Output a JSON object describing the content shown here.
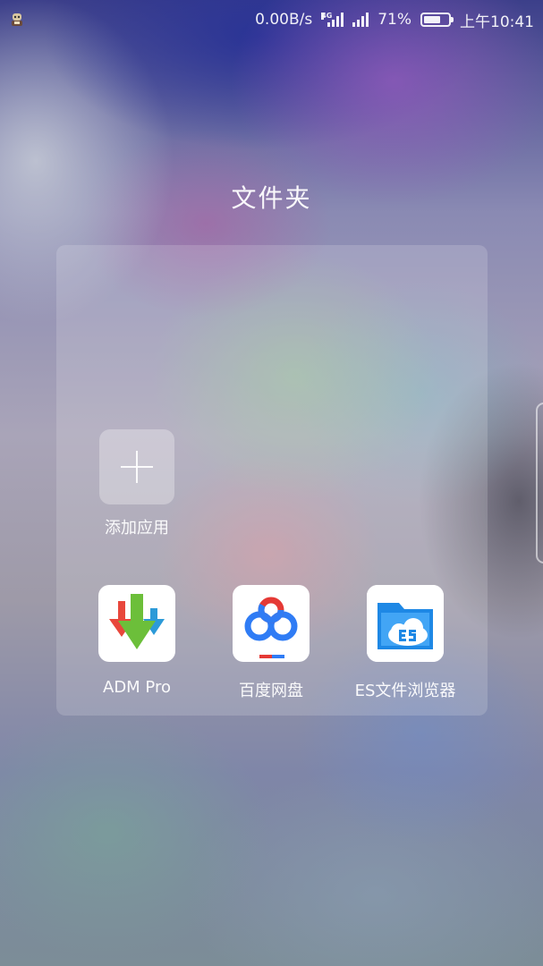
{
  "status_bar": {
    "net_speed": "0.00B/s",
    "network_type": "4G",
    "battery_percent": "71%",
    "battery_level": 0.71,
    "time": "上午10:41",
    "icons": [
      "notification-icon",
      "signal-4g-icon",
      "signal-icon",
      "battery-icon"
    ]
  },
  "folder": {
    "title": "文件夹",
    "add_label": "添加应用",
    "apps": [
      {
        "name": "ADM Pro",
        "icon": "adm-pro-icon"
      },
      {
        "name": "百度网盘",
        "icon": "baidu-netdisk-icon"
      },
      {
        "name": "ES文件浏览器",
        "icon": "es-file-explorer-icon"
      }
    ]
  },
  "colors": {
    "adm_red": "#e8473c",
    "adm_green": "#6cbf3a",
    "adm_blue": "#2c9ad8",
    "baidu_blue": "#2f7cf5",
    "baidu_red": "#e53935",
    "es_blue": "#1e88e5"
  }
}
